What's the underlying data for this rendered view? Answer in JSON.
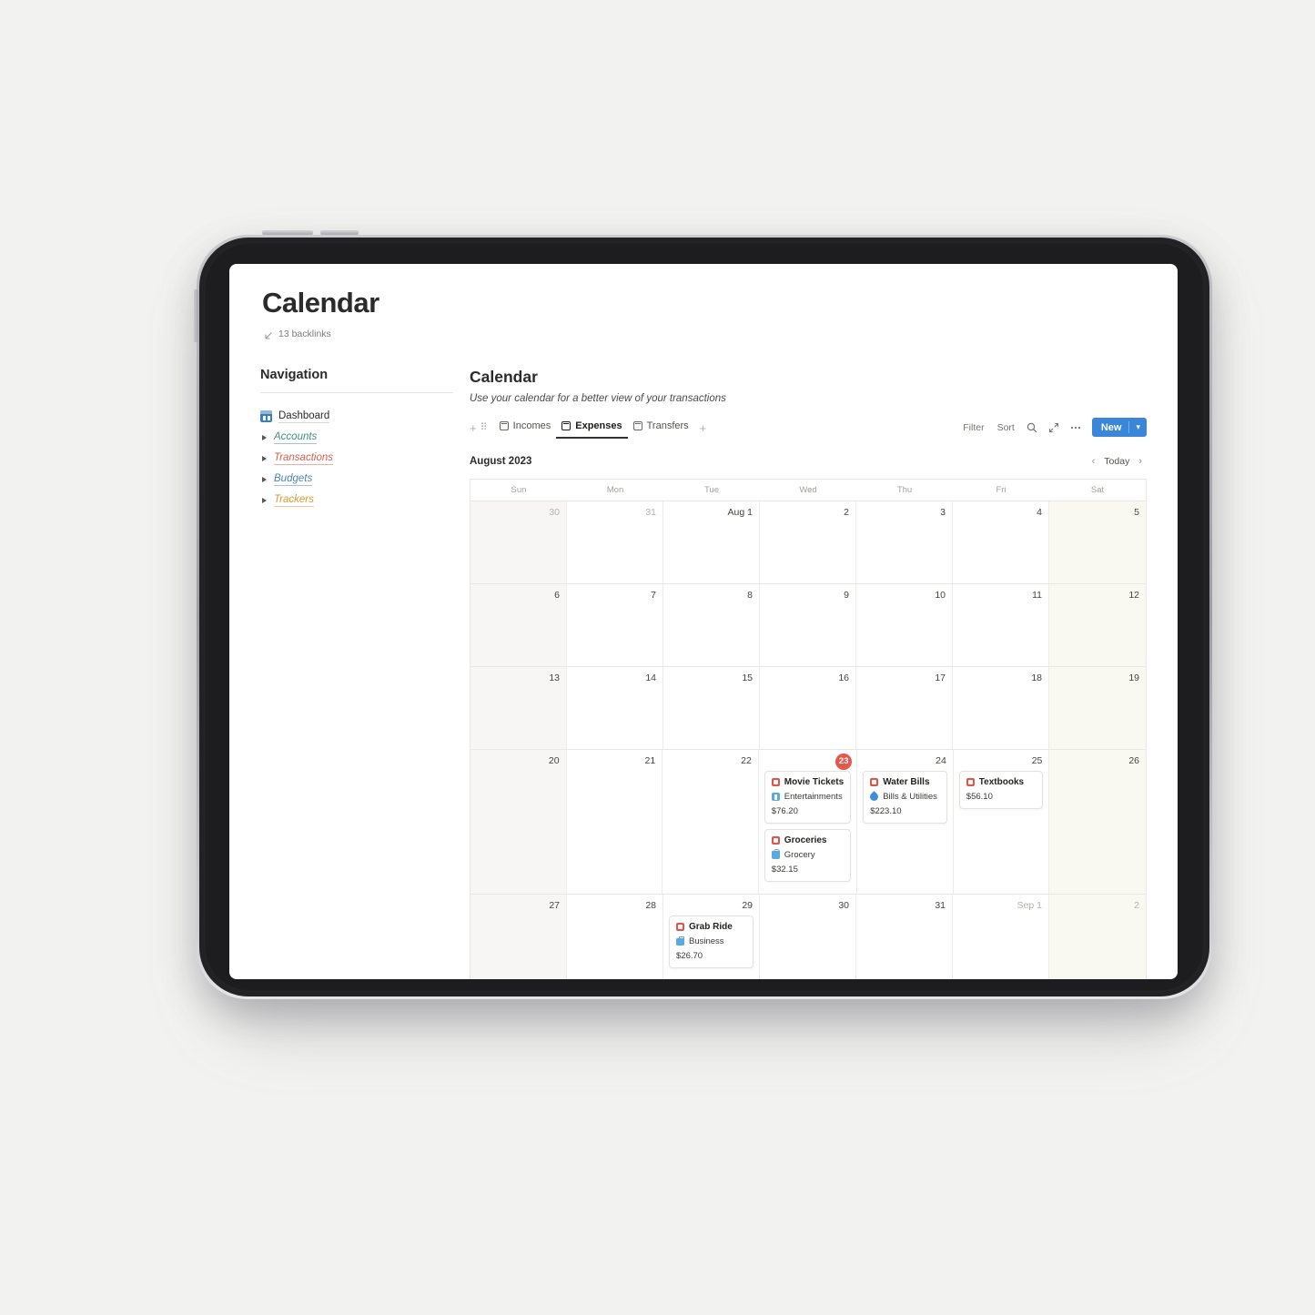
{
  "page": {
    "title": "Calendar",
    "backlinks": "13 backlinks"
  },
  "sidebar": {
    "heading": "Navigation",
    "items": [
      {
        "label": "Dashboard",
        "type": "page",
        "icon": "dashboard-icon",
        "color": "#2b2b2b"
      },
      {
        "label": "Accounts",
        "type": "toggle",
        "icon": "triangle-right-icon",
        "color": "#3f8f7d"
      },
      {
        "label": "Transactions",
        "type": "toggle",
        "icon": "triangle-right-icon",
        "color": "#d4604f"
      },
      {
        "label": "Budgets",
        "type": "toggle",
        "icon": "triangle-right-icon",
        "color": "#4a85b5"
      },
      {
        "label": "Trackers",
        "type": "toggle",
        "icon": "triangle-right-icon",
        "color": "#dd9a33"
      }
    ]
  },
  "database": {
    "title": "Calendar",
    "description": "Use your calendar for a better view of your transactions",
    "tabs": [
      {
        "label": "Incomes",
        "icon": "table-view-icon",
        "active": false
      },
      {
        "label": "Expenses",
        "icon": "calendar-view-icon",
        "active": true
      },
      {
        "label": "Transfers",
        "icon": "table-view-icon",
        "active": false
      }
    ],
    "add_view_label": "+",
    "add_block_label": "+",
    "drag_handle_label": "⠿",
    "toolbar": {
      "filter_label": "Filter",
      "sort_label": "Sort",
      "search_icon": "search-icon",
      "expand_icon": "expand-icon",
      "more_icon": "more-horizontal-icon",
      "new_label": "New",
      "new_chevron": "▾"
    }
  },
  "calendar": {
    "month_label": "August 2023",
    "prev_label": "‹",
    "today_label": "Today",
    "next_label": "›",
    "weekdays": [
      "Sun",
      "Mon",
      "Tue",
      "Wed",
      "Thu",
      "Fri",
      "Sat"
    ],
    "weeks": [
      [
        {
          "num": "30",
          "muted": true,
          "badge": false,
          "events": []
        },
        {
          "num": "31",
          "muted": true,
          "badge": false,
          "events": []
        },
        {
          "num": "Aug 1",
          "muted": false,
          "badge": false,
          "events": []
        },
        {
          "num": "2",
          "muted": false,
          "badge": false,
          "events": []
        },
        {
          "num": "3",
          "muted": false,
          "badge": false,
          "events": []
        },
        {
          "num": "4",
          "muted": false,
          "badge": false,
          "events": []
        },
        {
          "num": "5",
          "muted": false,
          "badge": false,
          "events": []
        }
      ],
      [
        {
          "num": "6",
          "muted": false,
          "badge": false,
          "events": []
        },
        {
          "num": "7",
          "muted": false,
          "badge": false,
          "events": []
        },
        {
          "num": "8",
          "muted": false,
          "badge": false,
          "events": []
        },
        {
          "num": "9",
          "muted": false,
          "badge": false,
          "events": []
        },
        {
          "num": "10",
          "muted": false,
          "badge": false,
          "events": []
        },
        {
          "num": "11",
          "muted": false,
          "badge": false,
          "events": []
        },
        {
          "num": "12",
          "muted": false,
          "badge": false,
          "events": []
        }
      ],
      [
        {
          "num": "13",
          "muted": false,
          "badge": false,
          "events": []
        },
        {
          "num": "14",
          "muted": false,
          "badge": false,
          "events": []
        },
        {
          "num": "15",
          "muted": false,
          "badge": false,
          "events": []
        },
        {
          "num": "16",
          "muted": false,
          "badge": false,
          "events": []
        },
        {
          "num": "17",
          "muted": false,
          "badge": false,
          "events": []
        },
        {
          "num": "18",
          "muted": false,
          "badge": false,
          "events": []
        },
        {
          "num": "19",
          "muted": false,
          "badge": false,
          "events": []
        }
      ],
      [
        {
          "num": "20",
          "muted": false,
          "badge": false,
          "events": []
        },
        {
          "num": "21",
          "muted": false,
          "badge": false,
          "events": []
        },
        {
          "num": "22",
          "muted": false,
          "badge": false,
          "events": []
        },
        {
          "num": "23",
          "muted": false,
          "badge": true,
          "events": [
            {
              "title": "Movie Tickets",
              "title_icon": "expense-red-icon",
              "category": "Entertainments",
              "category_icon": "ticket-blue-icon",
              "amount": "$76.20"
            },
            {
              "title": "Groceries",
              "title_icon": "expense-red-icon",
              "category": "Grocery",
              "category_icon": "shopping-bag-icon",
              "amount": "$32.15"
            }
          ]
        },
        {
          "num": "24",
          "muted": false,
          "badge": false,
          "events": [
            {
              "title": "Water Bills",
              "title_icon": "expense-red-icon",
              "category": "Bills & Utilities",
              "category_icon": "water-drop-icon",
              "amount": "$223.10"
            }
          ]
        },
        {
          "num": "25",
          "muted": false,
          "badge": false,
          "events": [
            {
              "title": "Textbooks",
              "title_icon": "expense-red-icon",
              "category": "",
              "category_icon": "",
              "amount": "$56.10"
            }
          ]
        },
        {
          "num": "26",
          "muted": false,
          "badge": false,
          "events": []
        }
      ],
      [
        {
          "num": "27",
          "muted": false,
          "badge": false,
          "events": []
        },
        {
          "num": "28",
          "muted": false,
          "badge": false,
          "events": []
        },
        {
          "num": "29",
          "muted": false,
          "badge": false,
          "events": [
            {
              "title": "Grab Ride",
              "title_icon": "expense-red-icon",
              "category": "Business",
              "category_icon": "briefcase-icon",
              "amount": "$26.70"
            }
          ]
        },
        {
          "num": "30",
          "muted": false,
          "badge": false,
          "events": []
        },
        {
          "num": "31",
          "muted": false,
          "badge": false,
          "events": []
        },
        {
          "num": "Sep 1",
          "muted": true,
          "badge": false,
          "events": []
        },
        {
          "num": "2",
          "muted": true,
          "badge": false,
          "events": []
        }
      ]
    ]
  },
  "colors": {
    "accent_blue": "#3a86d8",
    "today_red": "#e5574a",
    "expense_red": "#e0544a",
    "category_blue": "#5aa9e0",
    "sunday_bg": "#f7f6f4",
    "saturday_bg": "#faf9f1"
  }
}
